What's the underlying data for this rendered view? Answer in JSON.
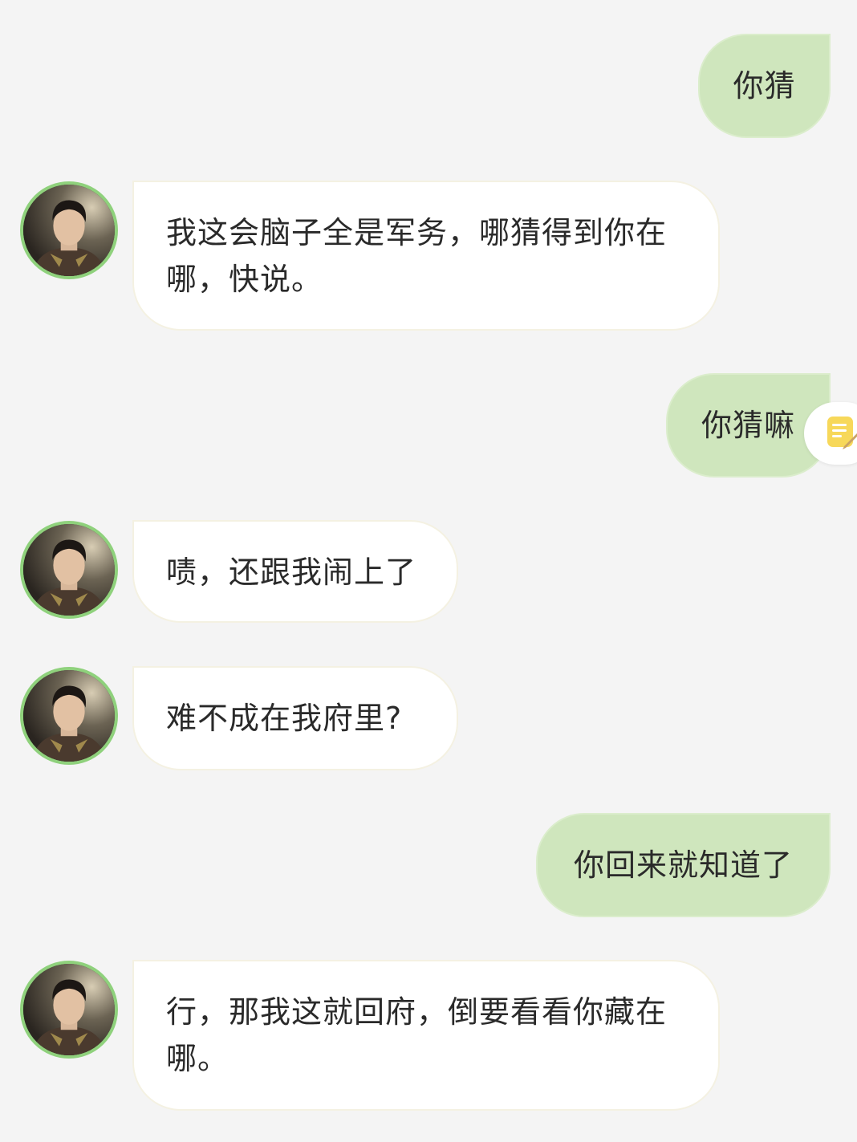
{
  "messages": [
    {
      "role": "user",
      "text": "你猜"
    },
    {
      "role": "assistant",
      "avatar_icon": "character-avatar",
      "text": "我这会脑子全是军务，哪猜得到你在哪，快说。"
    },
    {
      "role": "user",
      "text": "你猜嘛"
    },
    {
      "role": "assistant",
      "avatar_icon": "character-avatar",
      "text": "啧，还跟我闹上了"
    },
    {
      "role": "assistant",
      "avatar_icon": "character-avatar",
      "text": "难不成在我府里?"
    },
    {
      "role": "user",
      "text": "你回来就知道了"
    },
    {
      "role": "assistant",
      "avatar_icon": "character-avatar",
      "text": "行，那我这就回府，倒要看看你藏在哪。"
    }
  ],
  "floating_button": {
    "icon": "note-edit-icon"
  },
  "colors": {
    "background": "#f4f4f4",
    "user_bubble": "#cfe6bd",
    "assistant_bubble": "#ffffff",
    "avatar_ring": "#8fd17c",
    "note_icon": "#f7d85a"
  }
}
